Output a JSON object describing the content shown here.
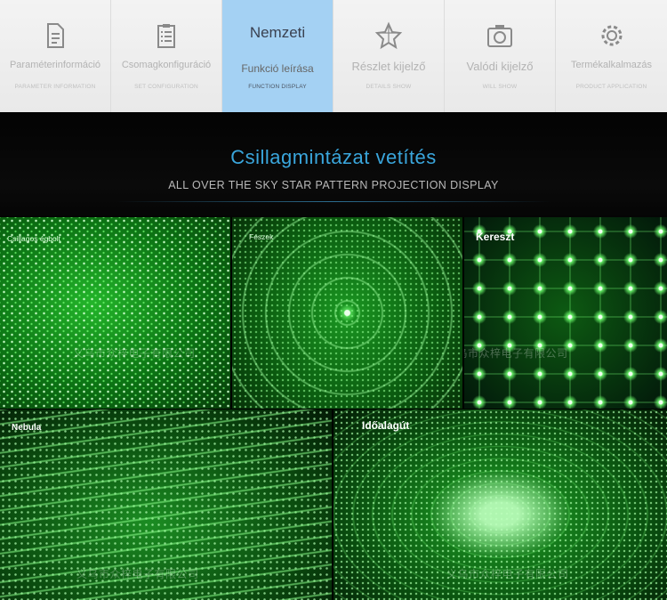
{
  "nav": {
    "tabs": [
      {
        "label": "Paraméterinformáció",
        "sub": "PARAMETER INFORMATION",
        "icon": "document-icon",
        "active": false
      },
      {
        "label": "Csomagkonfiguráció",
        "sub": "SET CONFIGURATION",
        "icon": "clipboard-list-icon",
        "active": false
      },
      {
        "main": "Nemzeti",
        "label": "Funkció leírása",
        "sub": "FUNCTION DISPLAY",
        "icon": "",
        "active": true
      },
      {
        "label": "Részlet kijelző",
        "sub": "DETAILS SHOW",
        "icon": "star-outline-icon",
        "active": false
      },
      {
        "label": "Valódi kijelző",
        "sub": "WILL SHOW",
        "icon": "camera-icon",
        "active": false
      },
      {
        "label": "Termékalkalmazás",
        "sub": "PRODUCT APPLICATION",
        "icon": "gear-icon",
        "active": false
      }
    ]
  },
  "hero": {
    "title": "Csillagmintázat vetítés",
    "subtitle": "ALL OVER THE SKY STAR PATTERN PROJECTION DISPLAY"
  },
  "panels": [
    {
      "label": "Csillagos égbolt",
      "watermark": "义乌市众梓电子有限公司"
    },
    {
      "label": "Fészek",
      "watermark": ""
    },
    {
      "label": "Kereszt",
      "watermark": "义乌市众梓电子有限公司"
    },
    {
      "label": "Nebula",
      "watermark": "义乌市众梓电子有限公司"
    },
    {
      "label": "Időalagút",
      "watermark": "义乌市众梓电子有限公司"
    }
  ],
  "colors": {
    "accent": "#3aa6dc",
    "active_tab": "#a4d1f3",
    "laser_green": "#1fa326"
  }
}
